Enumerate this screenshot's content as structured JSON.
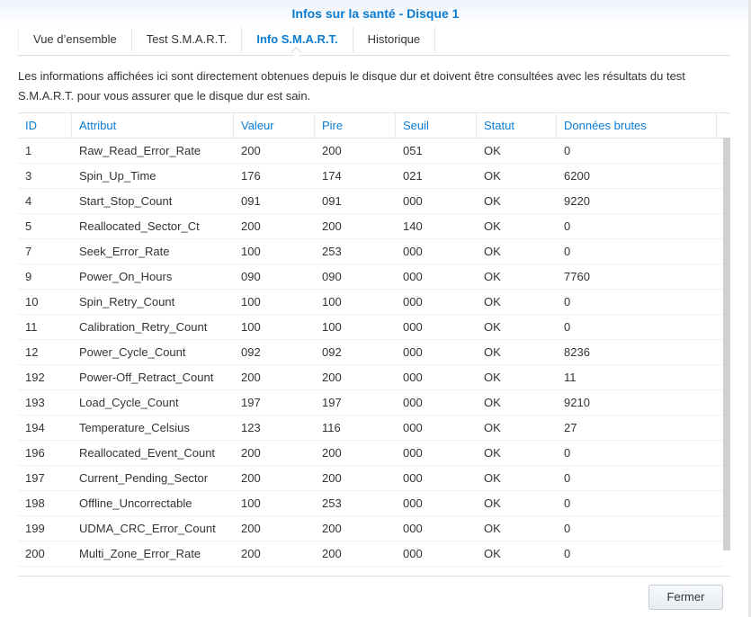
{
  "title": "Infos sur la santé - Disque 1",
  "tabs": [
    "Vue d’ensemble",
    "Test S.M.A.R.T.",
    "Info S.M.A.R.T.",
    "Historique"
  ],
  "active_tab": 2,
  "description": "Les informations affichées ici sont directement obtenues depuis le disque dur et doivent être consultées avec les résultats du test S.M.A.R.T. pour vous assurer que le disque dur est sain.",
  "columns": [
    "ID",
    "Attribut",
    "Valeur",
    "Pire",
    "Seuil",
    "Statut",
    "Données brutes"
  ],
  "rows": [
    [
      "1",
      "Raw_Read_Error_Rate",
      "200",
      "200",
      "051",
      "OK",
      "0"
    ],
    [
      "3",
      "Spin_Up_Time",
      "176",
      "174",
      "021",
      "OK",
      "6200"
    ],
    [
      "4",
      "Start_Stop_Count",
      "091",
      "091",
      "000",
      "OK",
      "9220"
    ],
    [
      "5",
      "Reallocated_Sector_Ct",
      "200",
      "200",
      "140",
      "OK",
      "0"
    ],
    [
      "7",
      "Seek_Error_Rate",
      "100",
      "253",
      "000",
      "OK",
      "0"
    ],
    [
      "9",
      "Power_On_Hours",
      "090",
      "090",
      "000",
      "OK",
      "7760"
    ],
    [
      "10",
      "Spin_Retry_Count",
      "100",
      "100",
      "000",
      "OK",
      "0"
    ],
    [
      "11",
      "Calibration_Retry_Count",
      "100",
      "100",
      "000",
      "OK",
      "0"
    ],
    [
      "12",
      "Power_Cycle_Count",
      "092",
      "092",
      "000",
      "OK",
      "8236"
    ],
    [
      "192",
      "Power-Off_Retract_Count",
      "200",
      "200",
      "000",
      "OK",
      "11"
    ],
    [
      "193",
      "Load_Cycle_Count",
      "197",
      "197",
      "000",
      "OK",
      "9210"
    ],
    [
      "194",
      "Temperature_Celsius",
      "123",
      "116",
      "000",
      "OK",
      "27"
    ],
    [
      "196",
      "Reallocated_Event_Count",
      "200",
      "200",
      "000",
      "OK",
      "0"
    ],
    [
      "197",
      "Current_Pending_Sector",
      "200",
      "200",
      "000",
      "OK",
      "0"
    ],
    [
      "198",
      "Offline_Uncorrectable",
      "100",
      "253",
      "000",
      "OK",
      "0"
    ],
    [
      "199",
      "UDMA_CRC_Error_Count",
      "200",
      "200",
      "000",
      "OK",
      "0"
    ],
    [
      "200",
      "Multi_Zone_Error_Rate",
      "200",
      "200",
      "000",
      "OK",
      "0"
    ]
  ],
  "close_label": "Fermer"
}
